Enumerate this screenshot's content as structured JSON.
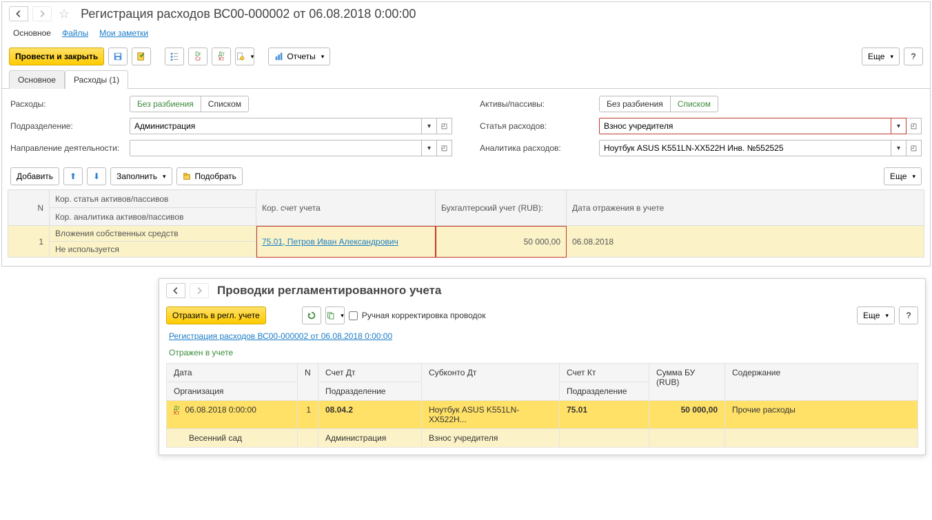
{
  "header": {
    "title": "Регистрация расходов ВС00-000002 от 06.08.2018 0:00:00",
    "subnav": {
      "main": "Основное",
      "files": "Файлы",
      "notes": "Мои заметки"
    }
  },
  "toolbar": {
    "commit_close": "Провести и закрыть",
    "reports": "Отчеты",
    "more": "Еще",
    "help": "?"
  },
  "tabs": {
    "main": "Основное",
    "expenses": "Расходы (1)"
  },
  "form": {
    "expenses_label": "Расходы:",
    "assets_label": "Активы/пассивы:",
    "subdiv_label": "Подразделение:",
    "subdiv_value": "Администрация",
    "item_label": "Статья расходов:",
    "item_value": "Взнос учредителя",
    "activity_label": "Направление деятельности:",
    "activity_value": "",
    "analytics_label": "Аналитика расходов:",
    "analytics_value": "Ноутбук ASUS K551LN-XX522H Инв. №552525",
    "no_split": "Без разбиения",
    "as_list": "Списком"
  },
  "row_toolbar": {
    "add": "Добавить",
    "fill": "Заполнить",
    "pick": "Подобрать",
    "more": "Еще"
  },
  "grid": {
    "cols": {
      "n": "N",
      "corr_item": "Кор. статья активов/пассивов",
      "corr_analytics": "Кор. аналитика активов/пассивов",
      "corr_account": "Кор. счет учета",
      "accounting_rub": "Бухгалтерский учет (RUB):",
      "reflect_date": "Дата отражения в учете"
    },
    "rows": [
      {
        "n": "1",
        "corr_item": "Вложения собственных средств",
        "corr_analytics": "Не используется",
        "corr_account": "75.01, Петров Иван Александрович",
        "amount": "50 000,00",
        "date": "06.08.2018"
      }
    ]
  },
  "window2": {
    "title": "Проводки регламентированного учета",
    "reflect_btn": "Отразить в регл. учете",
    "manual_label": "Ручная корректировка проводок",
    "more": "Еще",
    "help": "?",
    "doc_link": "Регистрация расходов ВС00-000002 от 06.08.2018 0:00:00",
    "status": "Отражен в учете",
    "cols": {
      "date": "Дата",
      "org": "Организация",
      "n": "N",
      "acc_dt": "Счет Дт",
      "subdiv": "Подразделение",
      "subkonto_dt": "Субконто Дт",
      "acc_kt": "Счет Кт",
      "subdiv2": "Подразделение",
      "sum": "Сумма БУ (RUB)",
      "content": "Содержание"
    },
    "row1": {
      "date": "06.08.2018 0:00:00",
      "n": "1",
      "acc_dt": "08.04.2",
      "subkonto": "Ноутбук ASUS K551LN-XX522H...",
      "acc_kt": "75.01",
      "sum": "50 000,00",
      "content": "Прочие расходы"
    },
    "row2": {
      "org": "Весенний сад",
      "subdiv": "Администрация",
      "subkonto": "Взнос учредителя"
    }
  }
}
